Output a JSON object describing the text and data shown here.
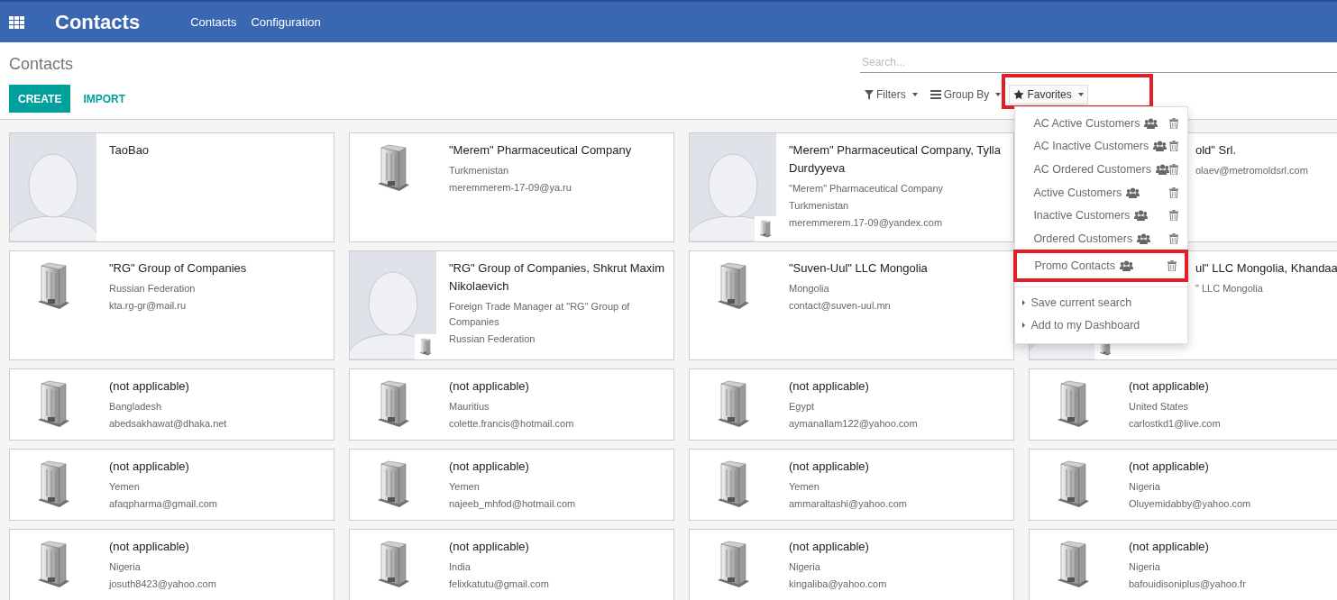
{
  "navbar": {
    "app_title": "Contacts",
    "menu": [
      "Contacts",
      "Configuration"
    ]
  },
  "control_panel": {
    "breadcrumb": "Contacts",
    "buttons": [
      {
        "label": "CREATE",
        "kind": "primary"
      },
      {
        "label": "IMPORT",
        "kind": "link"
      }
    ],
    "search": {
      "placeholder": "Search..."
    },
    "search_options": [
      {
        "label": "Filters",
        "kind": "filter",
        "selected": false,
        "highlighted": false
      },
      {
        "label": "Group By",
        "kind": "group",
        "selected": false,
        "highlighted": false
      },
      {
        "label": "Favorites",
        "kind": "star",
        "selected": true,
        "highlighted": true
      }
    ]
  },
  "favorites_menu": {
    "items": [
      {
        "label": "AC Active Customers",
        "shared": true,
        "highlighted": false
      },
      {
        "label": "AC Inactive Customers",
        "shared": true,
        "highlighted": false
      },
      {
        "label": "AC Ordered Customers",
        "shared": true,
        "highlighted": false
      },
      {
        "label": "Active Customers",
        "shared": true,
        "highlighted": false
      },
      {
        "label": "Inactive Customers",
        "shared": true,
        "highlighted": false
      },
      {
        "label": "Ordered Customers",
        "shared": true,
        "highlighted": false
      },
      {
        "label": "Promo Contacts",
        "shared": true,
        "highlighted": true
      }
    ],
    "actions": [
      "Save current search",
      "Add to my Dashboard"
    ]
  },
  "cards": [
    {
      "kind": "person",
      "title": "TaoBao"
    },
    {
      "kind": "company",
      "title": "\"Merem\" Pharmaceutical Company",
      "lines": [
        "Turkmenistan",
        "meremmerem-17-09@ya.ru"
      ]
    },
    {
      "kind": "person_company",
      "title": "\"Merem\" Pharmaceutical Company, Tylla Durdyyeva",
      "lines": [
        "\"Merem\" Pharmaceutical Company",
        "Turkmenistan",
        "meremmerem.17-09@yandex.com"
      ]
    },
    {
      "kind": "covered",
      "title": "old\" Srl.",
      "lines": [
        "olaev@metromoldsrl.com"
      ]
    },
    {
      "kind": "company",
      "title": "\"RG\" Group of Companies",
      "lines": [
        "Russian Federation",
        "kta.rg-gr@mail.ru"
      ]
    },
    {
      "kind": "person_company",
      "title": "\"RG\" Group of Companies, Shkrut Maxim Nikolaevich",
      "lines": [
        "Foreign Trade Manager at \"RG\" Group of Companies",
        "Russian Federation"
      ]
    },
    {
      "kind": "company",
      "title": "\"Suven-Uul\" LLC Mongolia",
      "lines": [
        "Mongolia",
        "contact@suven-uul.mn"
      ]
    },
    {
      "kind": "covered_person_company",
      "title": "ul\" LLC Mongolia, Khandaa",
      "lines": [
        "\" LLC Mongolia"
      ]
    },
    {
      "kind": "company",
      "title": "(not applicable)",
      "lines": [
        "Bangladesh",
        "abedsakhawat@dhaka.net"
      ]
    },
    {
      "kind": "company",
      "title": "(not applicable)",
      "lines": [
        "Mauritius",
        "colette.francis@hotmail.com"
      ]
    },
    {
      "kind": "company",
      "title": "(not applicable)",
      "lines": [
        "Egypt",
        "aymanallam122@yahoo.com"
      ]
    },
    {
      "kind": "company",
      "title": "(not applicable)",
      "lines": [
        "United States",
        "carlostkd1@live.com"
      ]
    },
    {
      "kind": "company",
      "title": "(not applicable)",
      "lines": [
        "Yemen",
        "afaqpharma@gmail.com"
      ]
    },
    {
      "kind": "company",
      "title": "(not applicable)",
      "lines": [
        "Yemen",
        "najeeb_mhfod@hotmail.com"
      ]
    },
    {
      "kind": "company",
      "title": "(not applicable)",
      "lines": [
        "Yemen",
        "ammaraltashi@yahoo.com"
      ]
    },
    {
      "kind": "company",
      "title": "(not applicable)",
      "lines": [
        "Nigeria",
        "Oluyemidabby@yahoo.com"
      ]
    },
    {
      "kind": "company",
      "title": "(not applicable)",
      "lines": [
        "Nigeria",
        "josuth8423@yahoo.com"
      ]
    },
    {
      "kind": "company",
      "title": "(not applicable)",
      "lines": [
        "India",
        "felixkatutu@gmail.com"
      ]
    },
    {
      "kind": "company",
      "title": "(not applicable)",
      "lines": [
        "Nigeria",
        "kingaliba@yahoo.com"
      ]
    },
    {
      "kind": "company",
      "title": "(not applicable)",
      "lines": [
        "Nigeria",
        "bafouidisoniplus@yahoo.fr"
      ]
    }
  ]
}
